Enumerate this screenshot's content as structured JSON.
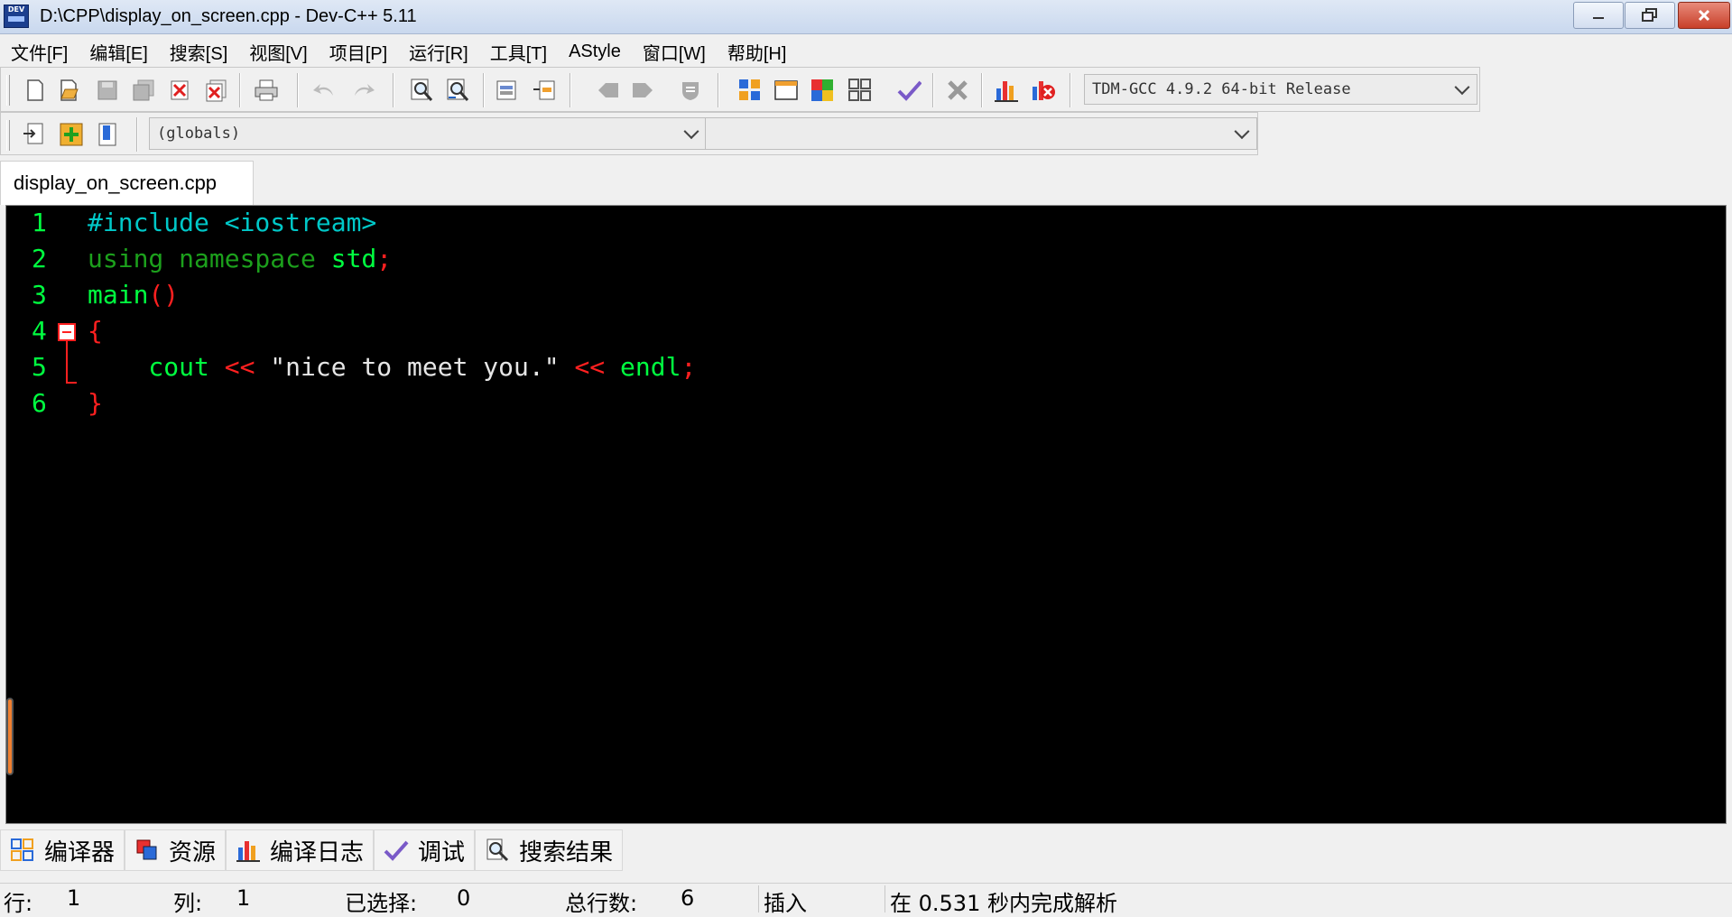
{
  "window": {
    "title": "D:\\CPP\\display_on_screen.cpp - Dev-C++ 5.11",
    "app_icon_text": "DEV"
  },
  "menu": [
    "文件[F]",
    "编辑[E]",
    "搜索[S]",
    "视图[V]",
    "项目[P]",
    "运行[R]",
    "工具[T]",
    "AStyle",
    "窗口[W]",
    "帮助[H]"
  ],
  "toolbar": {
    "compiler_select": "TDM-GCC 4.9.2 64-bit Release",
    "class_select": "(globals)",
    "member_select": ""
  },
  "tabs": [
    {
      "label": "display_on_screen.cpp",
      "active": true
    }
  ],
  "editor": {
    "lines": [
      {
        "n": "1",
        "tokens": [
          [
            "pp",
            "#include <iostream>"
          ]
        ]
      },
      {
        "n": "2",
        "tokens": [
          [
            "kw",
            "using namespace "
          ],
          [
            "id",
            "std"
          ],
          [
            "sym",
            ";"
          ]
        ]
      },
      {
        "n": "3",
        "tokens": [
          [
            "id",
            "main"
          ],
          [
            "sym",
            "()"
          ]
        ]
      },
      {
        "n": "4",
        "tokens": [
          [
            "sym",
            "{"
          ]
        ]
      },
      {
        "n": "5",
        "tokens": [
          [
            "id",
            "    cout "
          ],
          [
            "sym",
            "<<"
          ],
          [
            "str",
            " \"nice to meet you.\" "
          ],
          [
            "sym",
            "<<"
          ],
          [
            "id",
            " endl"
          ],
          [
            "sym",
            ";"
          ]
        ]
      },
      {
        "n": "6",
        "tokens": [
          [
            "sym",
            "}"
          ]
        ]
      }
    ],
    "colors": {
      "background": "#000000",
      "line_number": "#00ff40",
      "preprocessor": "#00c8c8",
      "keyword": "#1ca01c",
      "identifier": "#00ff40",
      "symbol": "#ff2020",
      "string": "#e6e6e6"
    }
  },
  "bottom_tabs": [
    {
      "label": "编译器",
      "icon": "compiler-grid-icon"
    },
    {
      "label": "资源",
      "icon": "resources-icon"
    },
    {
      "label": "编译日志",
      "icon": "bar-chart-icon"
    },
    {
      "label": "调试",
      "icon": "checkmark-icon"
    },
    {
      "label": "搜索结果",
      "icon": "search-results-icon"
    }
  ],
  "status": {
    "row_label": "行:",
    "row_value": "1",
    "col_label": "列:",
    "col_value": "1",
    "sel_label": "已选择:",
    "sel_value": "0",
    "total_label": "总行数:",
    "total_value": "6",
    "mode": "插入",
    "message": "在 0.531 秒内完成解析"
  }
}
